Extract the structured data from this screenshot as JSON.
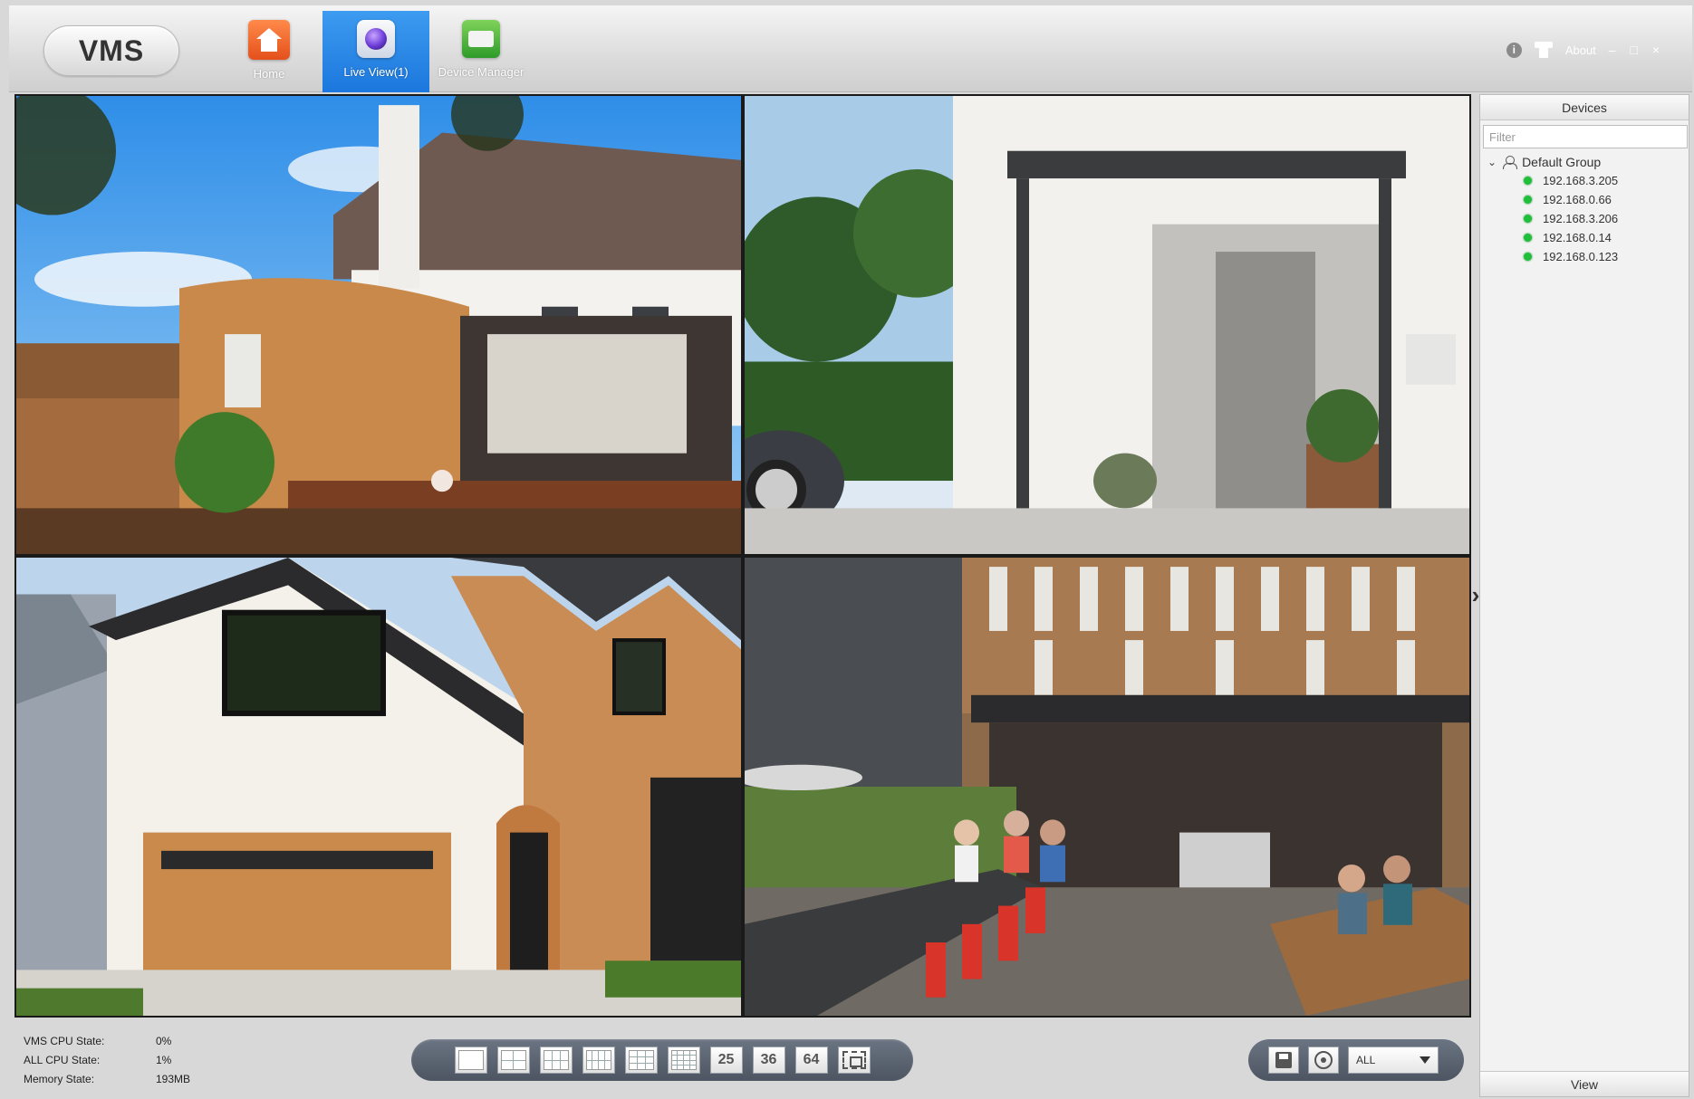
{
  "app": {
    "logo": "VMS"
  },
  "nav": [
    {
      "label": "Home",
      "icon": "home-icon",
      "active": false
    },
    {
      "label": "Live View(1)",
      "icon": "live-view-icon",
      "active": true
    },
    {
      "label": "Device Manager",
      "icon": "device-manager-icon",
      "active": false
    }
  ],
  "top_right": {
    "about_label": "About",
    "window_controls": "– □ ×"
  },
  "devices_panel": {
    "title": "Devices",
    "filter_placeholder": "Filter",
    "group_name": "Default Group",
    "items": [
      "192.168.3.205",
      "192.168.0.66",
      "192.168.3.206",
      "192.168.0.14",
      "192.168.0.123"
    ],
    "footer": "View",
    "status_color": "#1fbf3a"
  },
  "status": {
    "vms_cpu_label": "VMS CPU State:",
    "vms_cpu_value": "0%",
    "all_cpu_label": "ALL CPU State:",
    "all_cpu_value": "1%",
    "memory_label": "Memory State:",
    "memory_value": "193MB"
  },
  "layout_buttons": {
    "b25": "25",
    "b36": "36",
    "b64": "64"
  },
  "stream_select": {
    "value": "ALL"
  },
  "colors": {
    "accent": "#1b77dd",
    "toolbar": "#555d6a"
  }
}
